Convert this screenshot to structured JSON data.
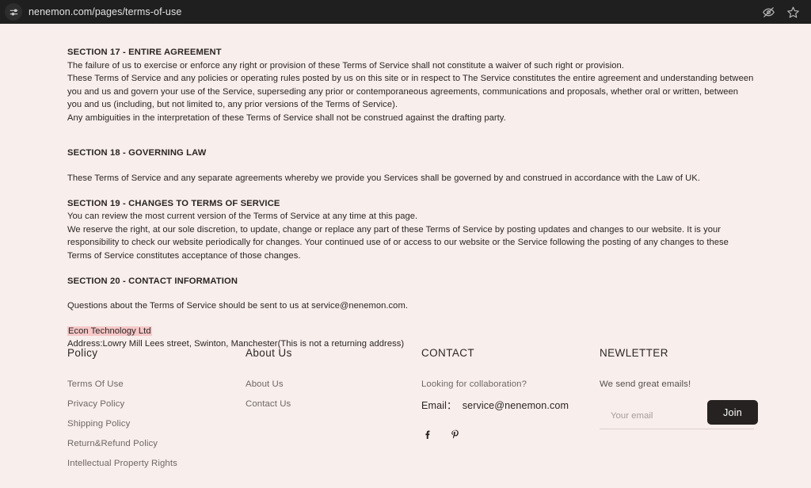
{
  "browser": {
    "url": "nenemon.com/pages/terms-of-use",
    "leading_icon": "page-settings-icon",
    "actions": [
      {
        "name": "hide-password-icon",
        "icon": "eye-slash-icon"
      },
      {
        "name": "bookmark-icon",
        "icon": "star-icon"
      }
    ]
  },
  "colors": {
    "page_background": "#f8eeec",
    "chrome_background": "#1f1f1f",
    "text": "#2a2522",
    "muted_text": "#6e6864",
    "selection_highlight": "#f6c8c8",
    "button_dark": "#262221"
  },
  "document": {
    "sections": [
      {
        "heading": "SECTION 17 - ENTIRE AGREEMENT",
        "lines": [
          "The failure of us to exercise or enforce any right or provision of these Terms of Service shall not constitute a waiver of such right or provision.",
          "These Terms of Service and any policies or operating rules posted by us on this site or in respect to The Service constitutes the entire agreement and understanding between you and us and govern your use of the Service, superseding any prior or contemporaneous agreements, communications and proposals, whether oral or written, between you and us (including, but not limited to, any prior versions of the Terms of Service).",
          "Any ambiguities in the interpretation of these Terms of Service shall not be construed against the drafting party."
        ]
      },
      {
        "heading": "SECTION 18 - GOVERNING LAW",
        "lines": [
          "These Terms of Service and any separate agreements whereby we provide you Services shall be governed by and construed in accordance with the Law of UK."
        ]
      },
      {
        "heading": "SECTION 19 - CHANGES TO TERMS OF SERVICE",
        "lines": [
          "You can review the most current version of the Terms of Service at any time at this page.",
          "We reserve the right, at our sole discretion, to update, change or replace any part of these Terms of Service by posting updates and changes to our website. It is your responsibility to check our website periodically for changes. Your continued use of or access to our website or the Service following the posting of any changes to these Terms of Service constitutes acceptance of those changes."
        ]
      },
      {
        "heading": "SECTION 20 - CONTACT INFORMATION",
        "lines": [
          "Questions about the Terms of Service should be sent to us at service@nenemon.com."
        ]
      }
    ],
    "company": {
      "name": "Econ Technology Ltd",
      "address": "Address:Lowry Mill Lees street, Swinton, Manchester(This is not a returning address)"
    }
  },
  "footer": {
    "policy": {
      "heading": "Policy",
      "links": [
        "Terms Of Use",
        "Privacy Policy",
        "Shipping Policy",
        "Return&Refund Policy",
        "Intellectual Property Rights"
      ]
    },
    "about": {
      "heading": "About Us",
      "links": [
        "About Us",
        "Contact Us"
      ]
    },
    "contact": {
      "heading": "CONTACT",
      "tagline": "Looking for collaboration?",
      "email_label": "Email：",
      "email": "service@nenemon.com",
      "socials": [
        {
          "name": "facebook-icon",
          "label": "f"
        },
        {
          "name": "pinterest-icon",
          "label": "P"
        }
      ]
    },
    "newsletter": {
      "heading": "NEWLETTER",
      "subtitle": "We send great emails!",
      "input_value": "",
      "input_placeholder": "Your email",
      "join_label": "Join"
    }
  }
}
